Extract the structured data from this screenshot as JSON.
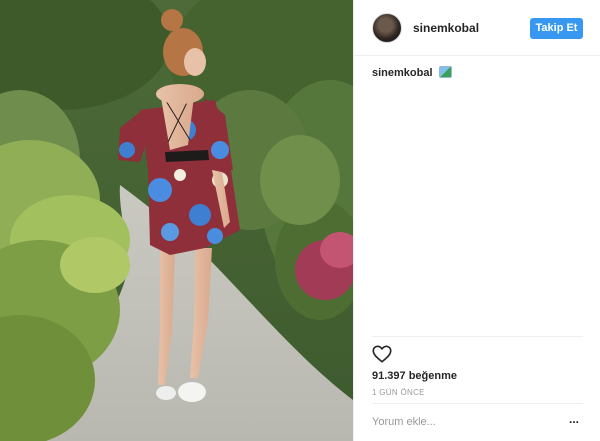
{
  "post": {
    "photo_alt": "sinemkobal gönderisi",
    "author": {
      "username": "sinemkobal",
      "avatar_icon": "profile-photo-icon"
    },
    "follow_label": "Takip Et",
    "caption": {
      "username": "sinemkobal",
      "emoji_icon": "flag-emoji-icon"
    },
    "actions": {
      "like_icon": "heart-outline-icon"
    },
    "likes_text": "91.397 beğenme",
    "timestamp": "1 GÜN ÖNCE",
    "comment": {
      "placeholder": "Yorum ekle...",
      "more_label": "..."
    }
  },
  "colors": {
    "accent": "#3897f0",
    "text": "#262626",
    "muted": "#999999",
    "border": "#efefef"
  }
}
